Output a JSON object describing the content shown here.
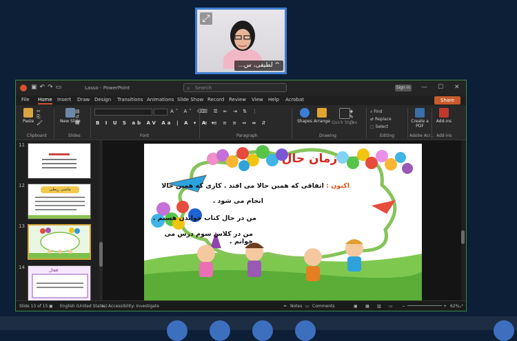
{
  "video": {
    "participant_name": "لطیفی، س...",
    "expand_icon": "expand-icon",
    "mic_icon": "mic-icon"
  },
  "window": {
    "title": "Lasso - PowerPoint",
    "search_placeholder": "Search",
    "signin_label": "Sign in",
    "minimize_label": "—",
    "restore_label": "☐",
    "close_label": "✕"
  },
  "tabs": [
    "File",
    "Home",
    "Insert",
    "Draw",
    "Design",
    "Transitions",
    "Animations",
    "Slide Show",
    "Record",
    "Review",
    "View",
    "Help",
    "Acrobat"
  ],
  "active_tab": "Home",
  "share_label": "Share",
  "ribbon": {
    "paste_label": "Paste",
    "new_slide_label": "New Slide",
    "shapes_label": "Shapes",
    "arrange_label": "Arrange",
    "quick_styles_label": "Quick Styles",
    "find_label": "Find",
    "replace_label": "Replace",
    "select_label": "Select",
    "create_pdf_label": "Create a PDF",
    "add_ins_label": "Add-ins",
    "groups": [
      "Clipboard",
      "Slides",
      "Font",
      "Paragraph",
      "Drawing",
      "Editing",
      "Adobe Acr...",
      "Add-ins"
    ]
  },
  "thumbnails": [
    {
      "number": "11",
      "title": ""
    },
    {
      "number": "12",
      "title": "ماضی ربطی"
    },
    {
      "number": "13",
      "title": ""
    },
    {
      "number": "14",
      "title": "افعال"
    }
  ],
  "slide": {
    "title": "زمان حال",
    "line1_highlight": "اکنون :",
    "line1_rest": " اتفاقی که همین حالا می افتد . کاری که همین حالا",
    "line2": "انجام می شود .",
    "line3": "من در حال کتاب خواندن هستم .",
    "line4": "من در کلاس سوم درس می خوانم ."
  },
  "status": {
    "slide_indicator": "Slide 13 of 15",
    "language": "English (United States)",
    "accessibility": "Accessibility: Investigate",
    "notes_label": "Notes",
    "comments_label": "Comments",
    "zoom": "62%"
  }
}
